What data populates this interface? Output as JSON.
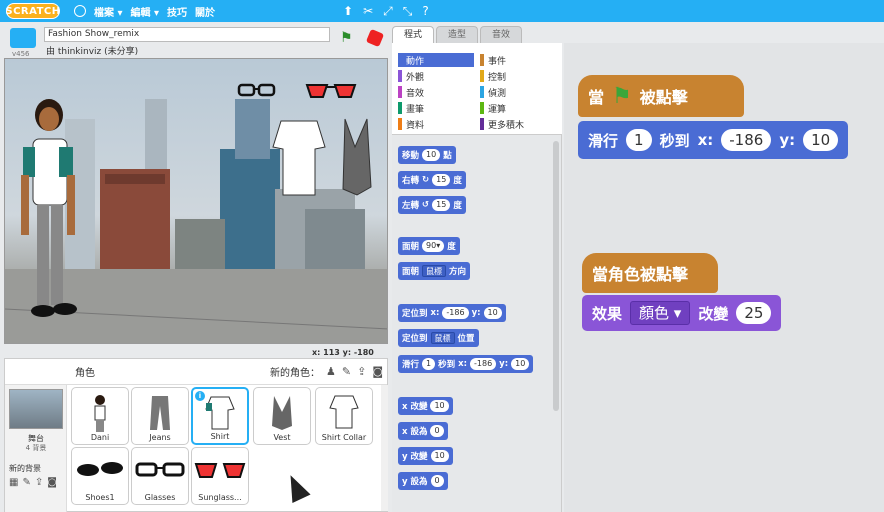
{
  "menubar": {
    "logo": "SCRATCH",
    "items": [
      {
        "label": "檔案 ▾"
      },
      {
        "label": "編輯 ▾"
      },
      {
        "label": "技巧"
      },
      {
        "label": "關於"
      }
    ]
  },
  "stage": {
    "version": "v456",
    "project_title": "Fashion Show_remix",
    "author": "由 thinkinviz (未分享)",
    "coords": "x: 113   y: -180"
  },
  "sprites": {
    "title": "角色",
    "new_sprite": "新的角色：",
    "backdrop_label": "舞台",
    "backdrop_count": "4 背景",
    "new_backdrop": "新的背景",
    "items": [
      {
        "name": "Dani"
      },
      {
        "name": "Jeans"
      },
      {
        "name": "Shirt"
      },
      {
        "name": "Vest"
      },
      {
        "name": "Shirt Collar"
      },
      {
        "name": "Shoes1"
      },
      {
        "name": "Glasses"
      },
      {
        "name": "Sunglass..."
      }
    ]
  },
  "tabs": [
    {
      "label": "程式"
    },
    {
      "label": "造型"
    },
    {
      "label": "音效"
    }
  ],
  "categories": [
    {
      "label": "動作",
      "color": "#4a6cd4"
    },
    {
      "label": "事件",
      "color": "#c88330"
    },
    {
      "label": "外觀",
      "color": "#8a55d7"
    },
    {
      "label": "控制",
      "color": "#e1a91a"
    },
    {
      "label": "音效",
      "color": "#bb42c3"
    },
    {
      "label": "偵測",
      "color": "#2ca5e2"
    },
    {
      "label": "畫筆",
      "color": "#0e9a6c"
    },
    {
      "label": "運算",
      "color": "#5cb712"
    },
    {
      "label": "資料",
      "color": "#ee7d16"
    },
    {
      "label": "更多積木",
      "color": "#632d99"
    }
  ],
  "palette_blocks": {
    "move": {
      "text": "移動",
      "val": "10",
      "tail": "點"
    },
    "turn_right": {
      "text": "右轉",
      "val": "15",
      "tail": "度"
    },
    "turn_left": {
      "text": "左轉",
      "val": "15",
      "tail": "度"
    },
    "point_dir": {
      "text": "面朝",
      "val": "90▾",
      "tail": "度"
    },
    "point_towards": {
      "text": "面朝",
      "val": "鼠標",
      "tail": "方向"
    },
    "goto_xy": {
      "text": "定位到",
      "x_label": "x:",
      "x": "-186",
      "y_label": "y:",
      "y": "10"
    },
    "goto": {
      "text": "定位到",
      "val": "鼠標",
      "tail": "位置"
    },
    "glide": {
      "text": "滑行",
      "secs": "1",
      "mid": "秒到",
      "x_label": "x:",
      "x": "-186",
      "y_label": "y:",
      "y": "10"
    },
    "change_x": {
      "text": "x 改變",
      "val": "10"
    },
    "set_x": {
      "text": "x 設為",
      "val": "0"
    },
    "change_y": {
      "text": "y 改變",
      "val": "10"
    },
    "set_y": {
      "text": "y 設為",
      "val": "0"
    }
  },
  "scripts": {
    "s1_hat_a": "當",
    "s1_hat_b": "被點擊",
    "s1_glide": "滑行",
    "s1_secs": "1",
    "s1_mid": "秒到",
    "s1_xl": "x:",
    "s1_x": "-186",
    "s1_yl": "y:",
    "s1_y": "10",
    "s2_hat": "當角色被點擊",
    "s2_effect": "效果",
    "s2_dd": "顏色 ▾",
    "s2_change": "改變",
    "s2_val": "25"
  }
}
